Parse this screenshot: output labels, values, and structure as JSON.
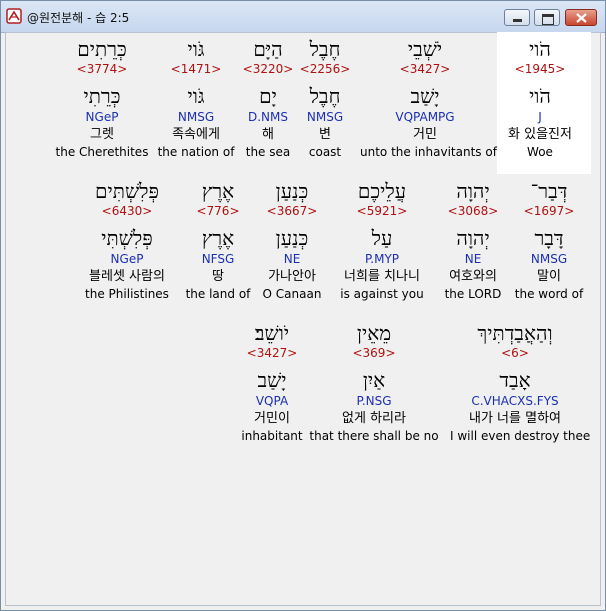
{
  "window": {
    "title": "@원전분해 - 습 2:5"
  },
  "words": [
    {
      "heb": "הֹוי",
      "strong": "<1945>",
      "heb_lex": "הֹוי",
      "morph": "J",
      "kor": "화 있을진저",
      "eng": "Woe"
    },
    {
      "heb": "יֹשְׁבֵי",
      "strong": "<3427>",
      "heb_lex": "יָשַׁב",
      "morph": "VQPAMPG",
      "kor": "거민",
      "eng": "unto the inhavitants of"
    },
    {
      "heb": "חֶבֶל",
      "strong": "<2256>",
      "heb_lex": "חֶבֶל",
      "morph": "NMSG",
      "kor": "변",
      "eng": "coast"
    },
    {
      "heb": "הַיָּם",
      "strong": "<3220>",
      "heb_lex": "יָם",
      "morph": "D.NMS",
      "kor": "해",
      "eng": "the sea"
    },
    {
      "heb": "גֹּוי",
      "strong": "<1471>",
      "heb_lex": "גֹּוי",
      "morph": "NMSG",
      "kor": "족속에게",
      "eng": "the nation of"
    },
    {
      "heb": "כְּרֵתִים",
      "strong": "<3774>",
      "heb_lex": "כְּרֵתִי",
      "morph": "NGeP",
      "kor": "그렛",
      "eng": "the Cherethites"
    },
    {
      "heb": "דְּבַר־",
      "strong": "<1697>",
      "heb_lex": "דָּבָר",
      "morph": "NMSG",
      "kor": "말이",
      "eng": "the word of"
    },
    {
      "heb": "יְהוָה",
      "strong": "<3068>",
      "heb_lex": "יְהוָה",
      "morph": "NE",
      "kor": "여호와의",
      "eng": "the LORD"
    },
    {
      "heb": "עֲלֵיכֶם",
      "strong": "<5921>",
      "heb_lex": "עַל",
      "morph": "P.MYP",
      "kor": "너희를 치나니",
      "eng": "is against you"
    },
    {
      "heb": "כְּנַעַן",
      "strong": "<3667>",
      "heb_lex": "כְּנַעַן",
      "morph": "NE",
      "kor": "가나안아",
      "eng": "O Canaan"
    },
    {
      "heb": "אֶרֶץ",
      "strong": "<776>",
      "heb_lex": "אֶרֶץ",
      "morph": "NFSG",
      "kor": "땅",
      "eng": "the land of"
    },
    {
      "heb": "פְּלִשְׁתִּים",
      "strong": "<6430>",
      "heb_lex": "פְּלִשְׁתִּי",
      "morph": "NGeP",
      "kor": "블레셋 사람의",
      "eng": "the Philistines"
    },
    {
      "heb": "וְהַאֲבַדְתִּיךְ",
      "strong": "<6>",
      "heb_lex": "אָבַד",
      "morph": "C.VHACXS.FYS",
      "kor": "내가 너를 멸하여",
      "eng": "I will even destroy thee"
    },
    {
      "heb": "מֵאֵין",
      "strong": "<369>",
      "heb_lex": "אַיִן",
      "morph": "P.NSG",
      "kor": "없게 하리라",
      "eng": "that there shall be no"
    },
    {
      "heb": "יֹושֵׁב׃",
      "strong": "<3427>",
      "heb_lex": "יָשַׁב",
      "morph": "VQPA",
      "kor": "거민이",
      "eng": "inhabitant"
    }
  ]
}
